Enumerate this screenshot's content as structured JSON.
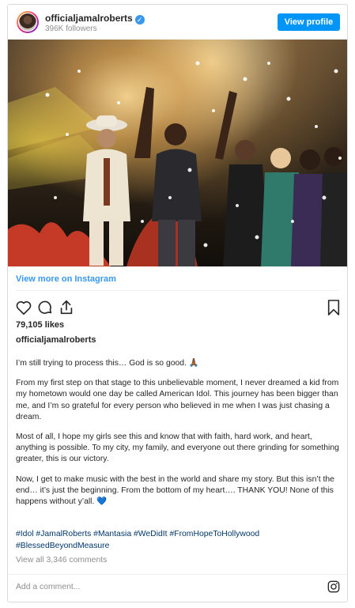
{
  "top_text": "",
  "header": {
    "username": "officialjamalroberts",
    "verified_icon": "verified-check-icon",
    "followers": "396K followers",
    "view_profile_label": "View profile"
  },
  "photo": {
    "description_icon": "stage-photo"
  },
  "view_more_label": "View more on Instagram",
  "actions": {
    "like_icon": "heart-icon",
    "comment_icon": "comment-icon",
    "share_icon": "share-icon",
    "save_icon": "bookmark-icon"
  },
  "likes": "79,105 likes",
  "caption_user": "officialjamalroberts",
  "caption_paragraphs": [
    "I’m still trying to process this… God is so good. 🙏🏾",
    "From my first step on that stage to this unbelievable moment, I never dreamed a kid from my hometown would one day be called American Idol. This journey has been bigger than me, and I’m so grateful for every person who believed in me when I was just chasing a dream.",
    "Most of all, I hope my girls see this and know that with faith, hard work, and heart, anything is possible. To my city, my family, and everyone out there grinding for something greater, this is our victory.",
    "Now, I get to make music with the best in the world and share my story. But this isn’t the end… it’s just the beginning. From the bottom of my heart…. THANK YOU! None of this happens without y’all. 💙"
  ],
  "hashtags_line1": "#Idol #JamalRoberts #Mantasia #WeDidIt #FromHopeToHollywood",
  "hashtags_line2": "#BlessedBeyondMeasure",
  "view_all_comments": "View all 3,346 comments",
  "comment_placeholder": "Add a comment...",
  "colors": {
    "accent": "#0095f6",
    "link": "#3897f0",
    "hashtag": "#00376b",
    "muted": "#8e8e8e"
  }
}
